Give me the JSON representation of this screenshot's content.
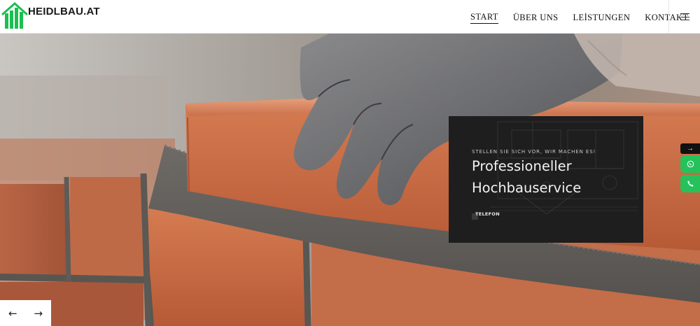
{
  "brand": {
    "name": "HEIDLBAU.AT",
    "icon": "building-bars-logo",
    "color": "#19c04f"
  },
  "nav": {
    "items": [
      {
        "label": "START",
        "active": true
      },
      {
        "label": "ÜBER UNS",
        "active": false
      },
      {
        "label": "LEİSTUNGEN",
        "active": false
      },
      {
        "label": "KONTAKT",
        "active": false
      }
    ],
    "menu_icon": "hamburger-icon"
  },
  "hero": {
    "subtitle": "STELLEN SIE SICH VOR, WIR MACHEN ES!",
    "title": "Professioneller Hochbauservice",
    "button_label": "TELEFON"
  },
  "side": {
    "arrow": "→",
    "whatsapp_icon": "whatsapp-icon",
    "phone_icon": "phone-icon",
    "color": "#25c25b"
  },
  "slider": {
    "prev": "←",
    "next": "→"
  }
}
